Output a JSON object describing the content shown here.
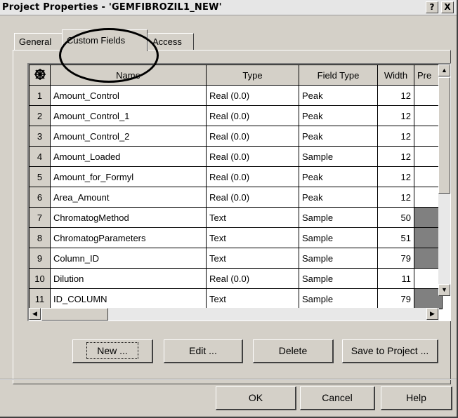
{
  "window": {
    "title": "Project Properties - 'GEMFIBROZIL1_NEW'",
    "help_button": "?",
    "close_button": "X"
  },
  "tabs": [
    {
      "label": "General"
    },
    {
      "label": "Custom Fields",
      "active": true
    },
    {
      "label": "Access"
    }
  ],
  "grid": {
    "corner_icon": "grid-select-all-icon",
    "columns": [
      "Name",
      "Type",
      "Field Type",
      "Width",
      "Pre"
    ],
    "rows": [
      {
        "n": "1",
        "name": "Amount_Control",
        "type": "Real (0.0)",
        "field_type": "Peak",
        "width": "12"
      },
      {
        "n": "2",
        "name": "Amount_Control_1",
        "type": "Real (0.0)",
        "field_type": "Peak",
        "width": "12"
      },
      {
        "n": "3",
        "name": "Amount_Control_2",
        "type": "Real (0.0)",
        "field_type": "Peak",
        "width": "12"
      },
      {
        "n": "4",
        "name": "Amount_Loaded",
        "type": "Real (0.0)",
        "field_type": "Sample",
        "width": "12"
      },
      {
        "n": "5",
        "name": "Amount_for_Formyl",
        "type": "Real (0.0)",
        "field_type": "Peak",
        "width": "12"
      },
      {
        "n": "6",
        "name": "Area_Amount",
        "type": "Real (0.0)",
        "field_type": "Peak",
        "width": "12"
      },
      {
        "n": "7",
        "name": "ChromatogMethod",
        "type": "Text",
        "field_type": "Sample",
        "width": "50"
      },
      {
        "n": "8",
        "name": "ChromatogParameters",
        "type": "Text",
        "field_type": "Sample",
        "width": "51"
      },
      {
        "n": "9",
        "name": "Column_ID",
        "type": "Text",
        "field_type": "Sample",
        "width": "79"
      },
      {
        "n": "10",
        "name": "Dilution",
        "type": "Real (0.0)",
        "field_type": "Sample",
        "width": "11"
      },
      {
        "n": "11",
        "name": "ID_COLUMN",
        "type": "Text",
        "field_type": "Sample",
        "width": "79"
      }
    ]
  },
  "actions": {
    "new": "New ...",
    "edit": "Edit ...",
    "delete": "Delete",
    "save_to_project": "Save to Project ..."
  },
  "footer": {
    "ok": "OK",
    "cancel": "Cancel",
    "help": "Help"
  },
  "colors": {
    "dialog_bg": "#d4d0c8",
    "shaded_cell": "#808080",
    "annotation_circle": "#000000"
  }
}
